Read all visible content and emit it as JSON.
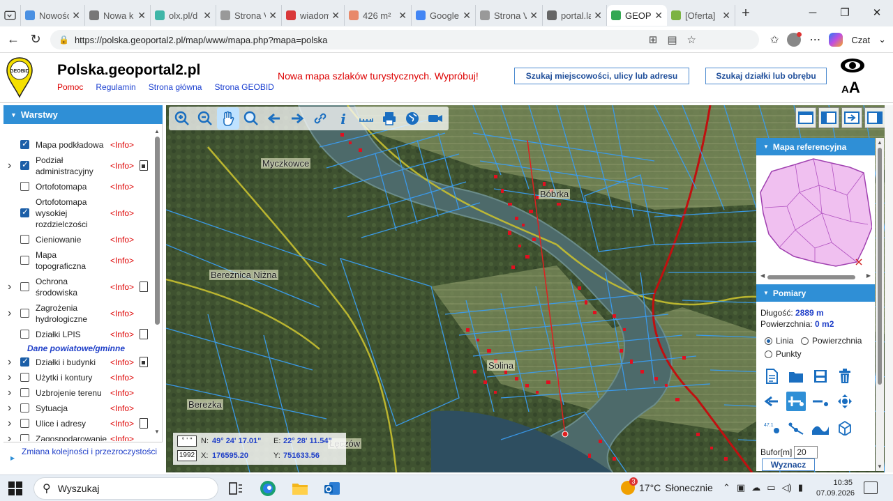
{
  "browser": {
    "tabs": [
      {
        "title": "Nowośc",
        "icon_color": "#4a90e2"
      },
      {
        "title": "Nowa k",
        "icon_color": "#777777"
      },
      {
        "title": "olx.pl/d",
        "icon_color": "#3fb6a8"
      },
      {
        "title": "Strona V",
        "icon_color": "#999999"
      },
      {
        "title": "wiadom",
        "icon_color": "#d9383a"
      },
      {
        "title": "426 m²",
        "icon_color": "#e8896a"
      },
      {
        "title": "Google",
        "icon_color": "#4285f4"
      },
      {
        "title": "Strona V",
        "icon_color": "#999999"
      },
      {
        "title": "portal.la",
        "icon_color": "#666666"
      },
      {
        "title": "GEOPOR",
        "icon_color": "#34a853",
        "active": true
      },
      {
        "title": "[Oferta]",
        "icon_color": "#7cb342"
      }
    ],
    "new_tab": "+",
    "url": "https://polska.geoportal2.pl/map/www/mapa.php?mapa=polska",
    "copilot_label": "Czat"
  },
  "site": {
    "title": "Polska.geoportal2.pl",
    "links": [
      "Pomoc",
      "Regulamin",
      "Strona główna",
      "Strona GEOBID"
    ],
    "promo": "Nowa mapa szlaków turystycznych. Wypróbuj!",
    "search_address": "Szukaj miejscowości, ulicy lub adresu",
    "search_parcel": "Szukaj działki lub obrębu",
    "logo_text": "GEOBID",
    "font_small": "A",
    "font_big": "A"
  },
  "layers": {
    "header": "Warstwy",
    "info": "<Info>",
    "items": [
      {
        "name": "Mapa podkładowa",
        "checked": true,
        "expand": false,
        "doc": ""
      },
      {
        "name": "Podział administracyjny",
        "checked": true,
        "expand": true,
        "doc": "lock"
      },
      {
        "name": "Ortofotomapa",
        "checked": false,
        "expand": false,
        "doc": ""
      },
      {
        "name": "Ortofotomapa wysokiej rozdzielczości",
        "checked": true,
        "expand": false,
        "doc": ""
      },
      {
        "name": "Cieniowanie",
        "checked": false,
        "expand": false,
        "doc": ""
      },
      {
        "name": "Mapa topograficzna",
        "checked": false,
        "expand": false,
        "doc": ""
      },
      {
        "name": "Ochrona środowiska",
        "checked": false,
        "expand": true,
        "doc": "doc"
      },
      {
        "name": "Zagrożenia hydrologiczne",
        "checked": false,
        "expand": true,
        "doc": ""
      },
      {
        "name": "Działki LPIS",
        "checked": false,
        "expand": false,
        "doc": "doc"
      }
    ],
    "section": "Dane powiatowe/gminne",
    "items2": [
      {
        "name": "Działki i budynki",
        "checked": true,
        "expand": true,
        "doc": "lock"
      },
      {
        "name": "Użytki i kontury",
        "checked": false,
        "expand": true,
        "doc": ""
      },
      {
        "name": "Uzbrojenie terenu",
        "checked": false,
        "expand": true,
        "doc": ""
      },
      {
        "name": "Sytuacja",
        "checked": false,
        "expand": true,
        "doc": ""
      },
      {
        "name": "Ulice i adresy",
        "checked": false,
        "expand": true,
        "doc": "doc"
      },
      {
        "name": "Zagospodarowanie",
        "checked": false,
        "expand": true,
        "doc": ""
      }
    ],
    "footer": "Zmiana kolejności i przezroczystości"
  },
  "map": {
    "places": [
      "Myczkowce",
      "Bóbrka",
      "Bereżnica Niżna",
      "Solina",
      "Berezka",
      "Łęczów"
    ],
    "coords": {
      "fmt_deg": "° ' \"",
      "fmt_1992": "1992",
      "n_label": "N:",
      "n_value": "49° 24' 17.01\"",
      "e_label": "E:",
      "e_value": "22° 28' 11.54\"",
      "x_label": "X:",
      "x_value": "176595.20",
      "y_label": "Y:",
      "y_value": "751633.56"
    }
  },
  "refmap": {
    "header": "Mapa referencyjna"
  },
  "measure": {
    "header": "Pomiary",
    "length_label": "Długość:",
    "length_value": "2889 m",
    "area_label": "Powierzchnia:",
    "area_value": "0 m2",
    "mode_line": "Linia",
    "mode_area": "Powierzchnia",
    "mode_points": "Punkty",
    "selected_mode": "Linia",
    "buffer_label": "Bufor[m]",
    "buffer_value": "20",
    "compute_button": "Wyznacz",
    "label_icon_text": "47.1"
  },
  "taskbar": {
    "search_placeholder": "Wyszukaj",
    "temperature": "17°C",
    "weather": "Słonecznie",
    "weather_badge": "3",
    "time": "10:35",
    "date": "07.09.2026"
  }
}
